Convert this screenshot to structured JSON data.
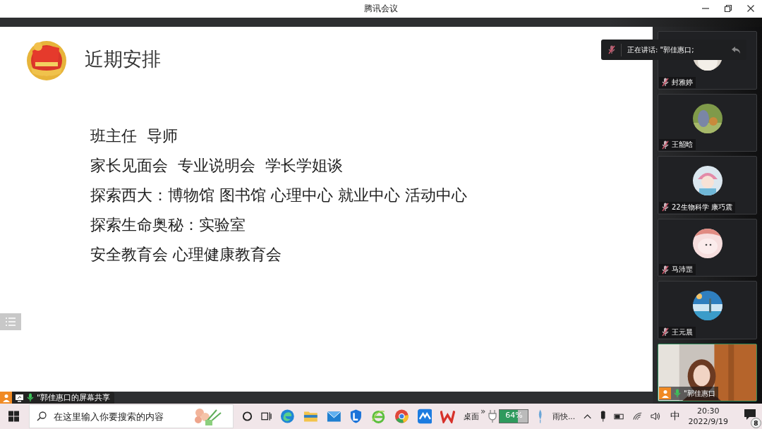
{
  "window": {
    "title": "腾讯会议"
  },
  "slide": {
    "title": "近期安排",
    "lines": [
      "班主任  导师",
      "家长见面会  专业说明会  学长学姐谈",
      "探索西大：博物馆 图书馆 心理中心 就业中心 活动中心",
      "探索生命奥秘：实验室",
      "安全教育会 心理健康教育会"
    ]
  },
  "speaking_tip": {
    "text": "正在讲话: \"郭佳惠口;"
  },
  "participants": [
    {
      "name": "封雅婷",
      "muted": true,
      "host": false,
      "kind": "avatar"
    },
    {
      "name": "王韶晗",
      "muted": true,
      "host": false,
      "kind": "avatar"
    },
    {
      "name": "22生物科学 康巧震",
      "muted": true,
      "host": false,
      "kind": "avatar"
    },
    {
      "name": "马沛罡",
      "muted": true,
      "host": false,
      "kind": "avatar"
    },
    {
      "name": "王元晨",
      "muted": true,
      "host": false,
      "kind": "avatar"
    },
    {
      "name": "\"郭佳惠口",
      "muted": false,
      "host": true,
      "kind": "video"
    }
  ],
  "share_bar": {
    "label": "\"郭佳惠口的屏幕共享",
    "muted": false
  },
  "taskbar": {
    "search_placeholder": "在这里输入你要搜索的内容",
    "desktop_label": "桌面",
    "overflow": "»",
    "battery": {
      "reading": "64%",
      "level": 0.64
    },
    "weather": "雨快...",
    "ime": "中",
    "time": "20:30",
    "date": "2022/9/19",
    "notifications": "8"
  }
}
